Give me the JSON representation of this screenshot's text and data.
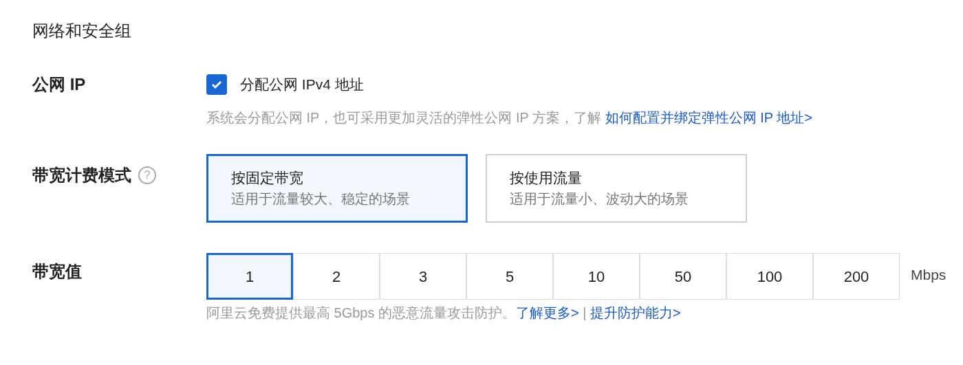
{
  "section_title": "网络和安全组",
  "public_ip": {
    "label": "公网 IP",
    "checkbox": {
      "label": "分配公网 IPv4 地址",
      "checked": true
    },
    "hint": "系统会分配公网 IP，也可采用更加灵活的弹性公网 IP 方案，了解 ",
    "hint_link": "如何配置并绑定弹性公网 IP 地址>"
  },
  "billing": {
    "label": "带宽计费模式",
    "help_icon": "?",
    "options": [
      {
        "title": "按固定带宽",
        "desc": "适用于流量较大、稳定的场景",
        "selected": true
      },
      {
        "title": "按使用流量",
        "desc": "适用于流量小、波动大的场景",
        "selected": false
      }
    ]
  },
  "bandwidth": {
    "label": "带宽值",
    "unit": "Mbps",
    "values": [
      {
        "label": "1",
        "selected": true
      },
      {
        "label": "2",
        "selected": false
      },
      {
        "label": "3",
        "selected": false
      },
      {
        "label": "5",
        "selected": false
      },
      {
        "label": "10",
        "selected": false
      },
      {
        "label": "50",
        "selected": false
      },
      {
        "label": "100",
        "selected": false
      },
      {
        "label": "200",
        "selected": false
      }
    ],
    "hint": "阿里云免费提供最高 5Gbps 的恶意流量攻击防护。",
    "link_1": "了解更多>",
    "separator": " | ",
    "link_2": "提升防护能力>"
  }
}
